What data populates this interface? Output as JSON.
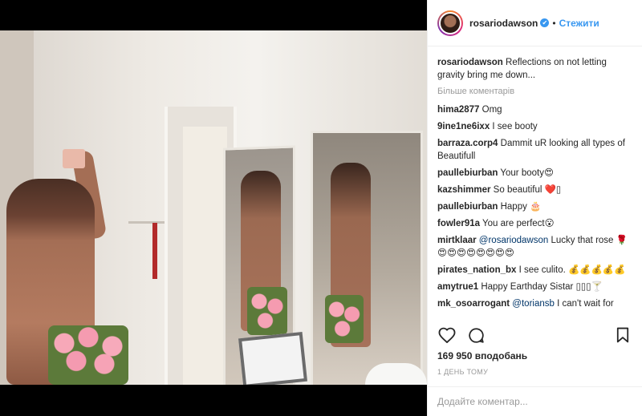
{
  "post": {
    "username": "rosariodawson",
    "follow_label": "Стежити",
    "separator": "•",
    "verified_icon": "✔",
    "caption_user": "rosariodawson",
    "caption_text": " Reflections on not letting gravity bring me down..."
  },
  "more_comments_label": "Більше коментарів",
  "comments": [
    {
      "user": "hima2877",
      "text": " Omg"
    },
    {
      "user": "9ine1ne6ixx",
      "text": " I see booty"
    },
    {
      "user": "barraza.corp4",
      "text": " Dammit uR looking all types of Beautifull"
    },
    {
      "user": "paullebiurban",
      "text": " Your booty😍"
    },
    {
      "user": "kazshimmer",
      "text": " So beautiful ❤️▯"
    },
    {
      "user": "paullebiurban",
      "text": " Happy 🎂"
    },
    {
      "user": "fowler91a",
      "text": " You are perfect😮"
    },
    {
      "user": "mirtklaar",
      "mention": " @rosariodawson",
      "text": " Lucky that rose 🌹😍😍😍😍😍😍😍😍"
    },
    {
      "user": "pirates_nation_bx",
      "text": " I see culito. 💰💰💰💰💰"
    },
    {
      "user": "amytrue1",
      "text": " Happy Earthday Sistar ▯▯▯🍸"
    },
    {
      "user": "mk_osoarrogant",
      "mention": " @toriansb",
      "text": " I can't wait for"
    }
  ],
  "likes": "169 950 вподобань",
  "time": "1 ДЕНЬ ТОМУ",
  "add_comment_placeholder": "Додайте коментар...",
  "icons": {
    "heart": "heart-icon",
    "comment": "comment-icon",
    "bookmark": "bookmark-icon"
  },
  "colors": {
    "link": "#3897f0",
    "mention": "#003569",
    "muted": "#999999"
  }
}
